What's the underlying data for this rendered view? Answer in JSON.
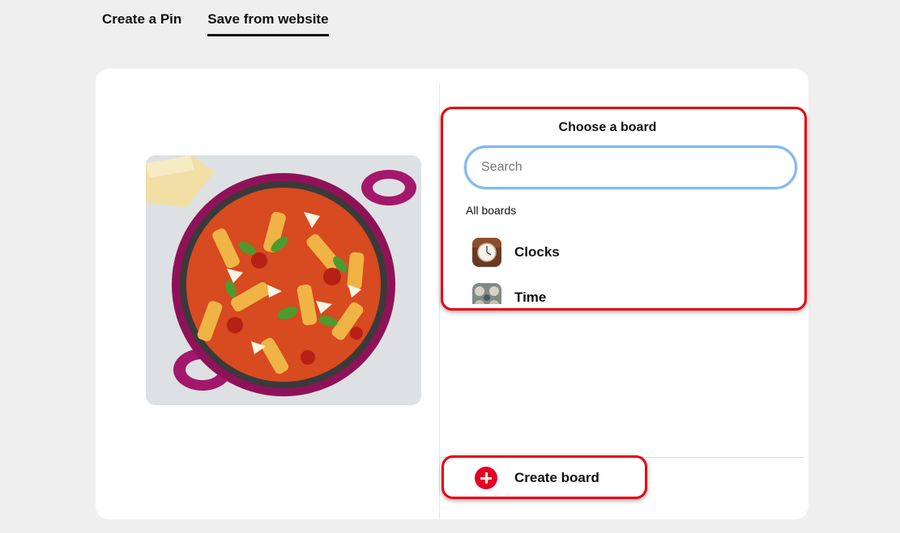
{
  "tabs": [
    {
      "label": "Create a Pin",
      "active": false
    },
    {
      "label": "Save from website",
      "active": true
    }
  ],
  "pin_image": {
    "icon": "pasta-dish-photo"
  },
  "board_picker": {
    "title": "Choose a board",
    "search": {
      "placeholder": "Search",
      "value": ""
    },
    "section_label": "All boards",
    "boards": [
      {
        "name": "Clocks",
        "thumb": "clock-photo"
      },
      {
        "name": "Time",
        "thumb": "watch-faces-photo"
      }
    ]
  },
  "create_board": {
    "label": "Create board",
    "icon": "plus-circle-icon"
  },
  "colors": {
    "accent_red": "#e60023",
    "highlight_red": "#e8000c",
    "search_focus_blue": "#83b9ec"
  }
}
